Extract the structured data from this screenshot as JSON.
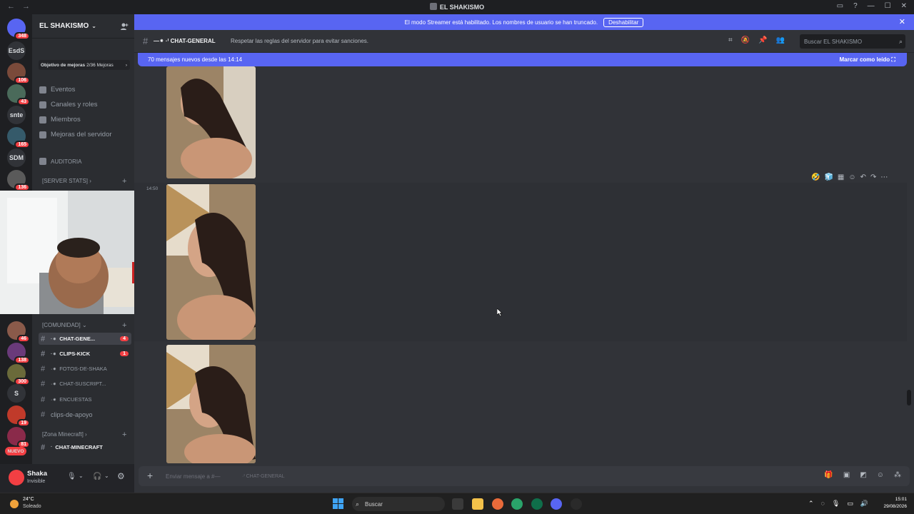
{
  "window": {
    "title": "EL SHAKISMO",
    "nav_back": "←",
    "nav_forward": "→",
    "controls": [
      "▭",
      "?",
      "—",
      "☐",
      "✕"
    ]
  },
  "servers": [
    {
      "name": "discord-home",
      "label": "",
      "badge": "348",
      "color": "#5865f2"
    },
    {
      "name": "EsdS",
      "label": "EsdS",
      "badge": ""
    },
    {
      "name": "server-2",
      "label": "",
      "badge": "106",
      "color": "#7a4a3a"
    },
    {
      "name": "server-3",
      "label": "",
      "badge": "43",
      "color": "#4a6a5a"
    },
    {
      "name": "snte",
      "label": "snte",
      "badge": ""
    },
    {
      "name": "server-5",
      "label": "",
      "badge": "165",
      "color": "#355a6a"
    },
    {
      "name": "SDM",
      "label": "SDM",
      "badge": ""
    },
    {
      "name": "server-7",
      "label": "",
      "badge": "136",
      "color": "#5a5a5a"
    },
    {
      "name": "server-8",
      "label": "",
      "badge": "46",
      "color": "#8a5a4a"
    },
    {
      "name": "server-9",
      "label": "",
      "badge": "138",
      "color": "#6a3a7a"
    },
    {
      "name": "server-10",
      "label": "",
      "badge": "300",
      "color": "#6a6a3a"
    },
    {
      "name": "S",
      "label": "S",
      "badge": ""
    },
    {
      "name": "server-12",
      "label": "",
      "badge": "19",
      "color": "#c03a2a"
    },
    {
      "name": "server-13",
      "label": "",
      "badge": "81",
      "color": "#8a2a4a"
    },
    {
      "name": "nuevo",
      "label": "NUEVO",
      "badge": ""
    }
  ],
  "sidebar": {
    "server_name": "EL SHAKISMO",
    "boost_label": "Objetivo de mejoras",
    "boost_count": "2/36 Mejoras",
    "items": [
      {
        "label": "Eventos"
      },
      {
        "label": "Canales y roles"
      },
      {
        "label": "Miembros"
      },
      {
        "label": "Mejoras del servidor"
      }
    ],
    "audit": "AUDITORIA",
    "categories": {
      "server_stats": "[SERVER STATS]",
      "comunidad": "[COMUNIDAD]",
      "minecraft": "[Zona Minecraft]"
    },
    "channels": [
      {
        "label": "CHAT-GENE...",
        "badge": "4"
      },
      {
        "label": "CLIPS-KICK",
        "badge": "1"
      },
      {
        "label": "FOTOS-DE-SHAKA",
        "badge": ""
      },
      {
        "label": "CHAT-SUSCRIPT...",
        "badge": ""
      },
      {
        "label": "ENCUESTAS",
        "badge": ""
      },
      {
        "label": "clips-de-apoyo",
        "badge": ""
      },
      {
        "label": "CHAT-MINECRAFT",
        "badge": ""
      }
    ]
  },
  "user": {
    "name": "Shaka",
    "status": "Invisible"
  },
  "streamer_banner": {
    "text": "El modo Streamer está habilitado. Los nombres de usuario se han truncado.",
    "button": "Deshabilitar"
  },
  "channel": {
    "name": "CHAT-GENERAL",
    "topic": "Respetar las reglas del servidor para evitar sanciones.",
    "search_placeholder": "Buscar EL SHAKISMO"
  },
  "new_messages": {
    "text": "70 mensajes nuevos desde las 14:14",
    "action": "Marcar como leído"
  },
  "messages": {
    "timestamp": "14:50"
  },
  "composer": {
    "placeholder": "Enviar mensaje a #—",
    "channel_suffix": "CHAT-GENERAL"
  },
  "taskbar": {
    "temperature": "24°C",
    "condition": "Soleado",
    "search": "Buscar",
    "time": "15:01",
    "date": "29/08/2026"
  }
}
